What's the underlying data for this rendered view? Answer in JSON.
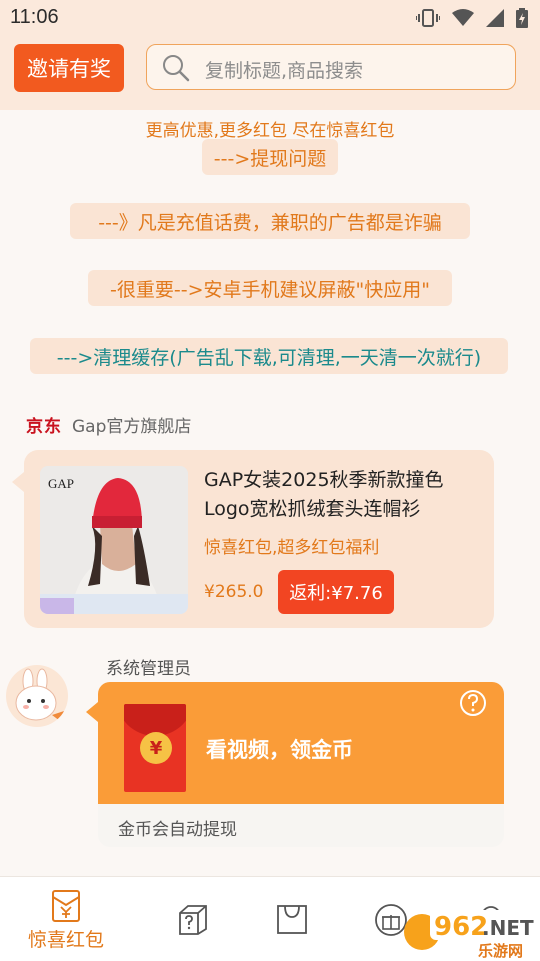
{
  "status_bar": {
    "time": "11:06"
  },
  "header": {
    "invite_label": "邀请有奖",
    "search_placeholder": "复制标题,商品搜索"
  },
  "banner": {
    "text": "更高优惠,更多红包 尽在惊喜红包"
  },
  "notices": [
    "--->提现问题",
    "---》凡是充值话费，兼职的广告都是诈骗",
    "-很重要-->安卓手机建议屏蔽\"快应用\"",
    "--->清理缓存(广告乱下载,可清理,一天清一次就行)"
  ],
  "shop": {
    "platform": "京东",
    "name": "Gap官方旗舰店"
  },
  "product": {
    "title": "GAP女装2025秋季新款撞色Logo宽松抓绒套头连帽衫",
    "subtitle": "惊喜红包,超多红包福利",
    "price": "¥265.0",
    "rebate": "返利:¥7.76",
    "image_brand": "GAP"
  },
  "admin_message": {
    "sender": "系统管理员",
    "title": "看视频，领金币",
    "footer": "金币会自动提现",
    "coin_symbol": "¥"
  },
  "bottom_nav": {
    "items": [
      {
        "label": "惊喜红包",
        "icon": "red-envelope-icon",
        "active": true
      },
      {
        "label": "",
        "icon": "question-box-icon"
      },
      {
        "label": "",
        "icon": "shopping-bag-icon"
      },
      {
        "label": "",
        "icon": "gift-icon"
      },
      {
        "label": "",
        "icon": "search-icon"
      }
    ]
  },
  "watermark": {
    "text1": "962",
    "text2": ".NET",
    "text3": "乐游网"
  },
  "colors": {
    "accent": "#f25a1f",
    "orange_text": "#e2791b",
    "teal_text": "#1b8a8c",
    "card_bg": "#fae4d4",
    "video_card": "#fa9c38"
  }
}
